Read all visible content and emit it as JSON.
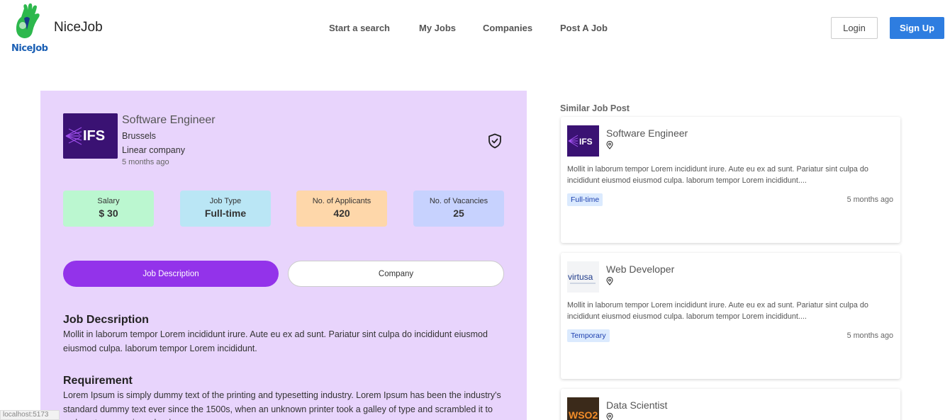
{
  "header": {
    "logo_text": "NiceJob",
    "brand": "NiceJob",
    "nav": [
      "Start a search",
      "My Jobs",
      "Companies",
      "Post A Job"
    ],
    "login": "Login",
    "signup": "Sign Up"
  },
  "job": {
    "logo_text": "IFS",
    "title": "Software Engineer",
    "location": "Brussels",
    "company": "Linear company",
    "posted": "5 months ago",
    "stats": [
      {
        "label": "Salary",
        "value": "$ 30",
        "color": "#bbf7d0"
      },
      {
        "label": "Job Type",
        "value": "Full-time",
        "color": "#bae6f5"
      },
      {
        "label": "No. of Applicants",
        "value": "420",
        "color": "#fed7aa"
      },
      {
        "label": "No. of Vacancies",
        "value": "25",
        "color": "#c7d2fe"
      }
    ],
    "tabs": {
      "active": "Job Description",
      "inactive": "Company"
    },
    "description_heading": "Job Decsription",
    "description": "Mollit in laborum tempor Lorem incididunt irure. Aute eu ex ad sunt. Pariatur sint culpa do incididunt eiusmod eiusmod culpa. laborum tempor Lorem incididunt.",
    "requirement_heading": "Requirement",
    "requirement": "Lorem Ipsum is simply dummy text of the printing and typesetting industry. Lorem Ipsum has been the industry's standard dummy text ever since the 1500s, when an unknown printer took a galley of type and scrambled it to make a type specimen book."
  },
  "similar": {
    "heading": "Similar Job Post",
    "cards": [
      {
        "title": "Software Engineer",
        "logo_text": "IFS",
        "desc": "Mollit in laborum tempor Lorem incididunt irure. Aute eu ex ad sunt. Pariatur sint culpa do incididunt eiusmod eiusmod culpa. laborum tempor Lorem incididunt....",
        "tag": "Full-time",
        "time": "5 months ago"
      },
      {
        "title": "Web Developer",
        "logo_text": "virtusa",
        "desc": "Mollit in laborum tempor Lorem incididunt irure. Aute eu ex ad sunt. Pariatur sint culpa do incididunt eiusmod eiusmod culpa. laborum tempor Lorem incididunt....",
        "tag": "Temporary",
        "time": "5 months ago"
      },
      {
        "title": "Data Scientist",
        "logo_text": "WSO2",
        "desc": "",
        "tag": "",
        "time": ""
      }
    ]
  },
  "status_bar": "localhost:5173",
  "colors": {
    "accent": "#9333ea",
    "panel": "#e8d4fc",
    "signup": "#2e7de0"
  }
}
